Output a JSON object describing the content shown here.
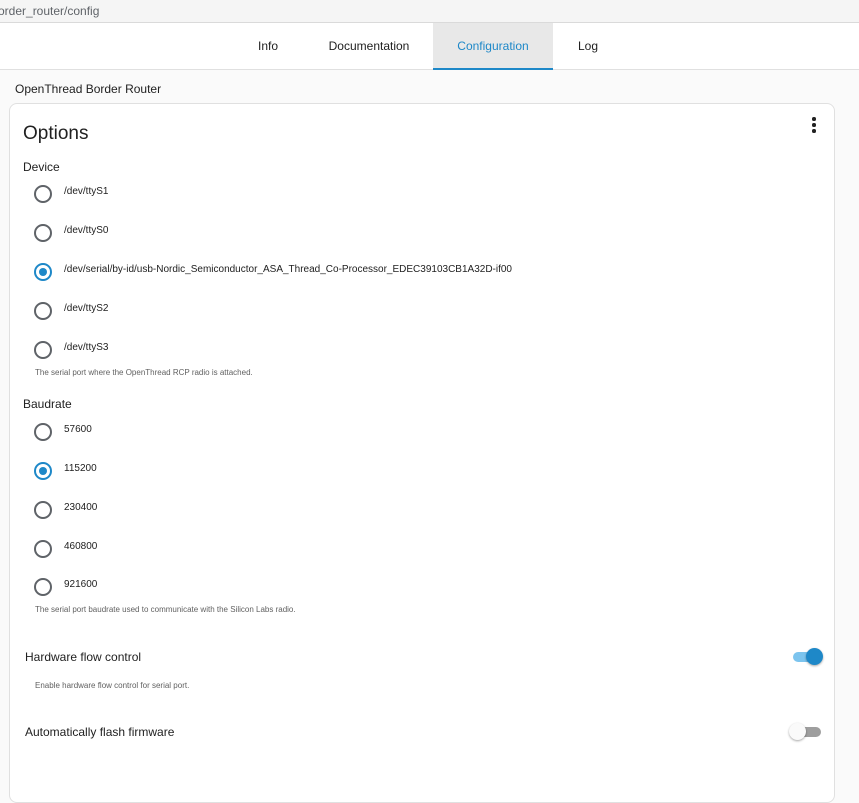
{
  "browser": {
    "url_fragment": "order_router/config"
  },
  "tabs": [
    {
      "label": "Info"
    },
    {
      "label": "Documentation"
    },
    {
      "label": "Configuration",
      "active": true
    },
    {
      "label": "Log"
    }
  ],
  "addon_title": "OpenThread Border Router",
  "card": {
    "title": "Options",
    "device": {
      "label": "Device",
      "options": [
        {
          "label": "/dev/ttyS1",
          "selected": false
        },
        {
          "label": "/dev/ttyS0",
          "selected": false
        },
        {
          "label": "/dev/serial/by-id/usb-Nordic_Semiconductor_ASA_Thread_Co-Processor_EDEC39103CB1A32D-if00",
          "selected": true
        },
        {
          "label": "/dev/ttyS2",
          "selected": false
        },
        {
          "label": "/dev/ttyS3",
          "selected": false
        }
      ],
      "helper": "The serial port where the OpenThread RCP radio is attached."
    },
    "baudrate": {
      "label": "Baudrate",
      "options": [
        {
          "label": "57600",
          "selected": false
        },
        {
          "label": "115200",
          "selected": true
        },
        {
          "label": "230400",
          "selected": false
        },
        {
          "label": "460800",
          "selected": false
        },
        {
          "label": "921600",
          "selected": false
        }
      ],
      "helper": "The serial port baudrate used to communicate with the Silicon Labs radio."
    },
    "hardware_flow_control": {
      "label": "Hardware flow control",
      "enabled": true,
      "helper": "Enable hardware flow control for serial port."
    },
    "auto_flash_firmware": {
      "label": "Automatically flash firmware",
      "enabled": false
    }
  },
  "colors": {
    "accent": "#1e88c8",
    "accent_light": "#7cc4ee",
    "switch_off": "#9e9e9e"
  },
  "icons": {
    "card_menu": "more-vert-icon"
  }
}
